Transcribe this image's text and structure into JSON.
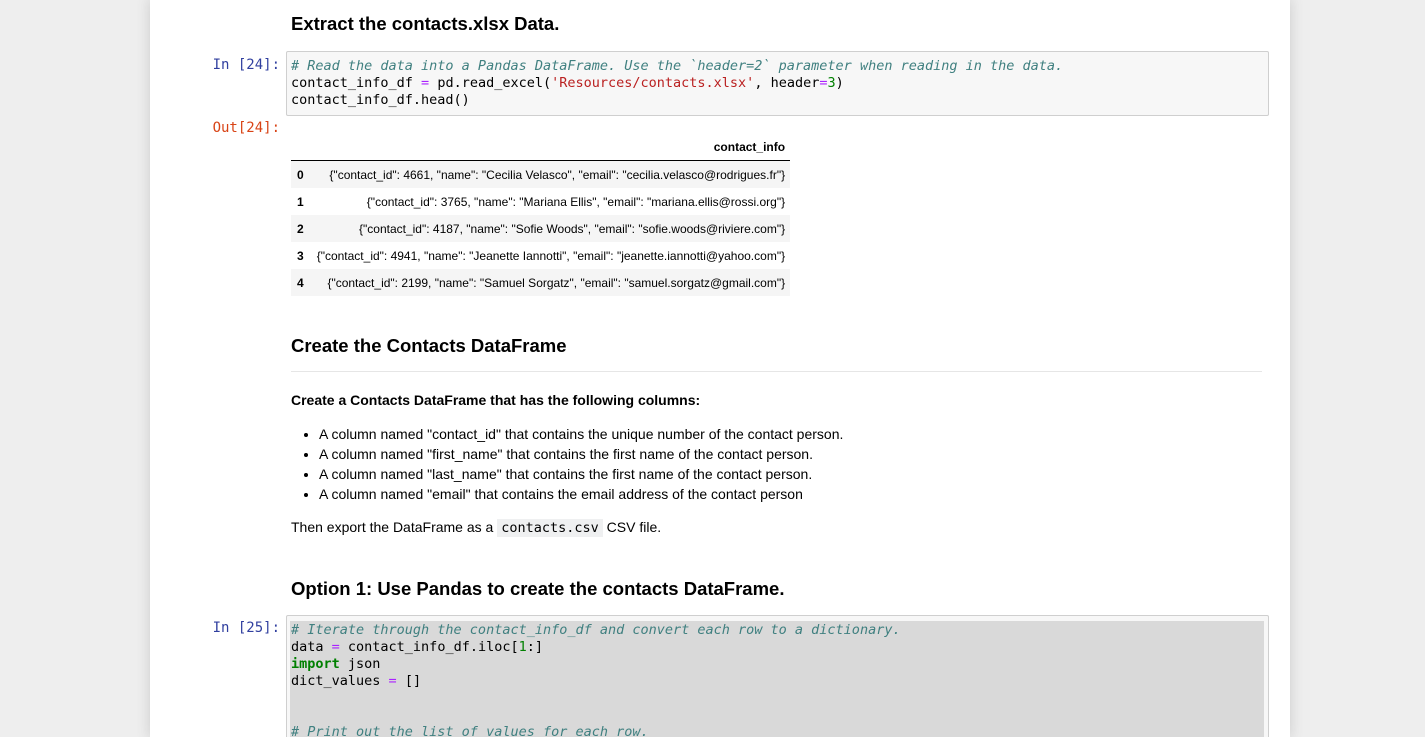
{
  "section1": {
    "heading": "Extract the contacts.xlsx Data."
  },
  "cell24": {
    "in_prompt": "In [24]:",
    "out_prompt": "Out[24]:",
    "line1_comment": "# Read the data into a Pandas DataFrame. Use the `header=2` parameter when reading in the data.",
    "line2_a": "contact_info_df ",
    "line2_op": "=",
    "line2_b": " pd.read_excel(",
    "line2_str": "'Resources/contacts.xlsx'",
    "line2_c": ", header",
    "line2_op2": "=",
    "line2_num": "3",
    "line2_d": ")",
    "line3": "contact_info_df.head()"
  },
  "table": {
    "column_header": "contact_info",
    "rows": [
      {
        "index": "0",
        "value": "{\"contact_id\": 4661, \"name\": \"Cecilia Velasco\", \"email\": \"cecilia.velasco@rodrigues.fr\"}"
      },
      {
        "index": "1",
        "value": "{\"contact_id\": 3765, \"name\": \"Mariana Ellis\", \"email\": \"mariana.ellis@rossi.org\"}"
      },
      {
        "index": "2",
        "value": "{\"contact_id\": 4187, \"name\": \"Sofie Woods\", \"email\": \"sofie.woods@riviere.com\"}"
      },
      {
        "index": "3",
        "value": "{\"contact_id\": 4941, \"name\": \"Jeanette Iannotti\", \"email\": \"jeanette.iannotti@yahoo.com\"}"
      },
      {
        "index": "4",
        "value": "{\"contact_id\": 2199, \"name\": \"Samuel Sorgatz\", \"email\": \"samuel.sorgatz@gmail.com\"}"
      }
    ]
  },
  "section2": {
    "heading": "Create the Contacts DataFrame",
    "subheading": "Create a Contacts DataFrame that has the following columns:",
    "bullets": [
      "A column named \"contact_id\" that contains the unique number of the contact person.",
      "A column named \"first_name\" that contains the first name of the contact person.",
      "A column named \"last_name\" that contains the first name of the contact person.",
      "A column named \"email\" that contains the email address of the contact person"
    ],
    "export_pre": "Then export the DataFrame as a ",
    "export_code": "contacts.csv",
    "export_post": " CSV file."
  },
  "section3": {
    "heading": "Option 1: Use Pandas to create the contacts DataFrame."
  },
  "cell25": {
    "in_prompt": "In [25]:",
    "line1_comment": "# Iterate through the contact_info_df and convert each row to a dictionary.",
    "line2_a": "data ",
    "line2_op": "=",
    "line2_b": " contact_info_df.iloc[",
    "line2_num": "1",
    "line2_c": ":]",
    "line3_kw": "import",
    "line3_b": " json",
    "line4_a": "dict_values ",
    "line4_op": "=",
    "line4_b": " []",
    "line7_comment": "# Print out the list of values for each row."
  }
}
